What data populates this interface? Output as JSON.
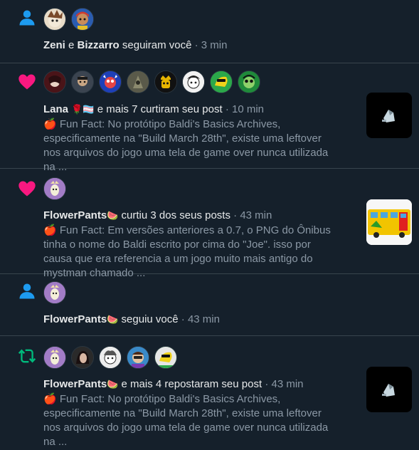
{
  "colors": {
    "background": "#15202b",
    "divider": "#38444d",
    "follow_icon": "#1d9bf0",
    "like_icon": "#f91880",
    "repost_icon": "#00ba7c",
    "secondary_text": "#8b98a5"
  },
  "notifications": [
    {
      "type": "follow",
      "icon": "person-icon",
      "name_a": "Zeni",
      "conj": "e",
      "name_b": "Bizzarro",
      "verb": "seguiram você",
      "sep": "·",
      "time": "3 min",
      "avatars": [
        "avatar-zeni",
        "avatar-bizzarro"
      ]
    },
    {
      "type": "like",
      "icon": "heart-icon",
      "name": "Lana",
      "name_emoji": "🌹🏳️‍⚧️",
      "verb": "e mais 7 curtiram seu post",
      "sep": "·",
      "time": "10 min",
      "snippet": "🍎 Fun Fact: No protótipo Baldi's Basics Archives, especificamente na \"Build March 28th\", existe uma leftover nos arquivos do jogo uma tela de game over nunca utilizada na ...",
      "thumbnail": "post-thumbnail-gameover"
    },
    {
      "type": "like",
      "icon": "heart-icon",
      "name": "FlowerPants",
      "name_emoji": "🍉",
      "verb": "curtiu 3 dos seus posts",
      "sep": "·",
      "time": "43 min",
      "snippet": "🍎 Fun Fact: Em versões anteriores a 0.7, o PNG do Ônibus tinha o nome do Baldi escrito por cima do \"Joe\". isso por causa que era referencia a um jogo muito mais antigo do mystman chamado ...",
      "thumbnail": "post-thumbnail-bus"
    },
    {
      "type": "follow",
      "icon": "person-icon",
      "name": "FlowerPants",
      "name_emoji": "🍉",
      "verb": "seguiu você",
      "sep": "·",
      "time": "43 min"
    },
    {
      "type": "repost",
      "icon": "repost-icon",
      "name": "FlowerPants",
      "name_emoji": "🍉",
      "verb": "e mais 4 repostaram seu post",
      "sep": "·",
      "time": "43 min",
      "snippet": "🍎 Fun Fact: No protótipo Baldi's Basics Archives, especificamente na \"Build March 28th\", existe uma leftover nos arquivos do jogo uma tela de game over nunca utilizada na ...",
      "thumbnail": "post-thumbnail-gameover"
    }
  ]
}
